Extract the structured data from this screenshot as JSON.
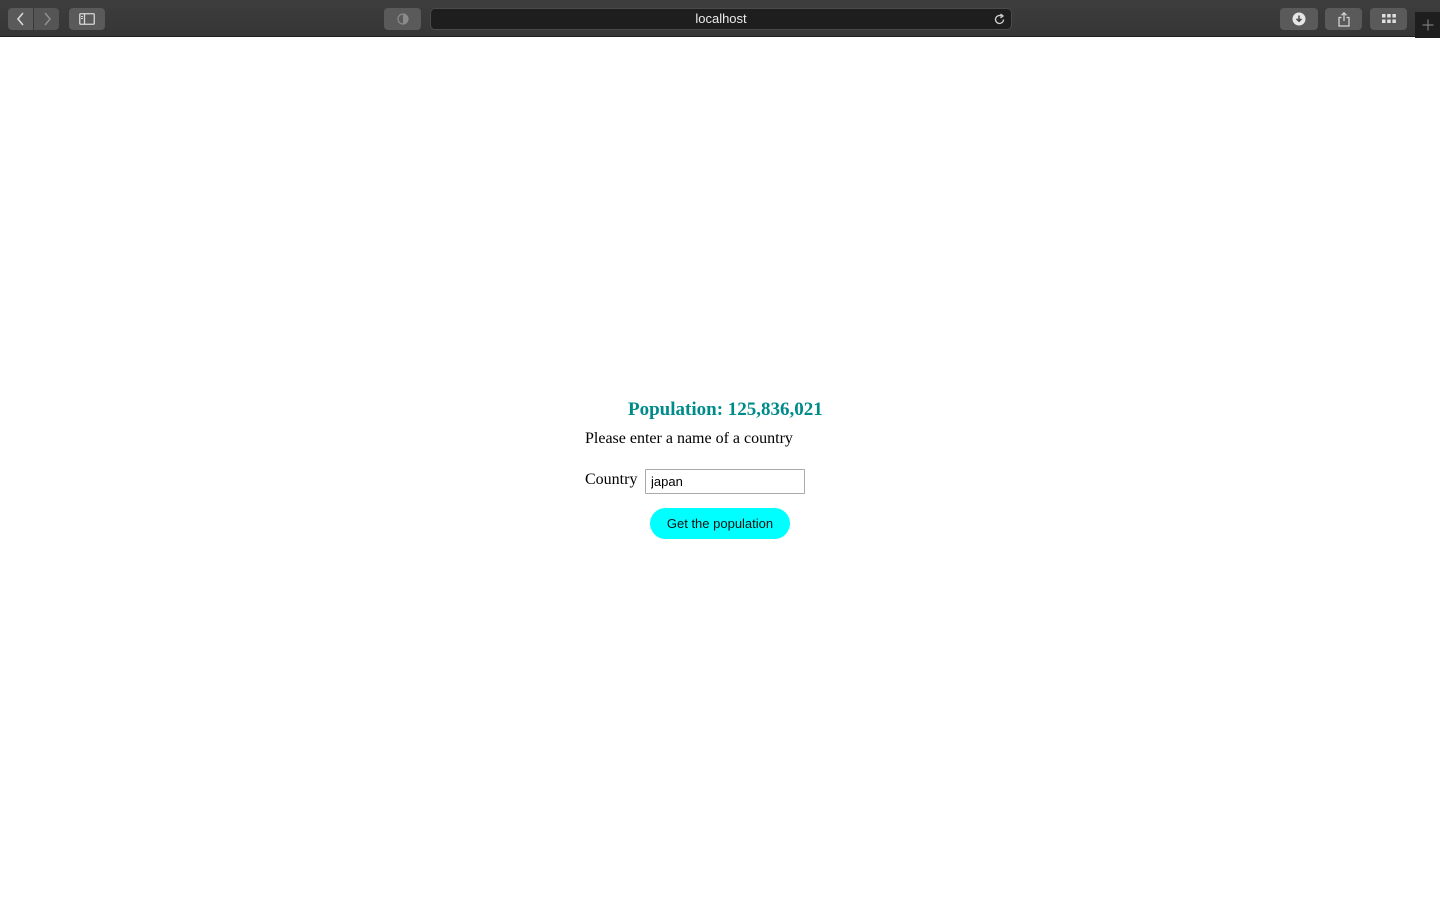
{
  "browser": {
    "address": "localhost",
    "icons": {
      "back": "chevron-left-icon",
      "forward": "chevron-right-icon",
      "sidebar": "sidebar-icon",
      "privacy": "privacy-shield-icon",
      "reload": "reload-icon",
      "downloads": "download-icon",
      "share": "share-icon",
      "tabs": "grid-icon",
      "new_tab": "plus-icon"
    }
  },
  "page": {
    "population_text": "Population: 125,836,021",
    "prompt": "Please enter a name of a country",
    "country_label": "Country",
    "country_value": "japan",
    "submit_label": "Get the population"
  },
  "colors": {
    "population_text": "#008b8b",
    "button_bg": "#00ffff",
    "toolbar_bg": "#3a3a3a"
  }
}
